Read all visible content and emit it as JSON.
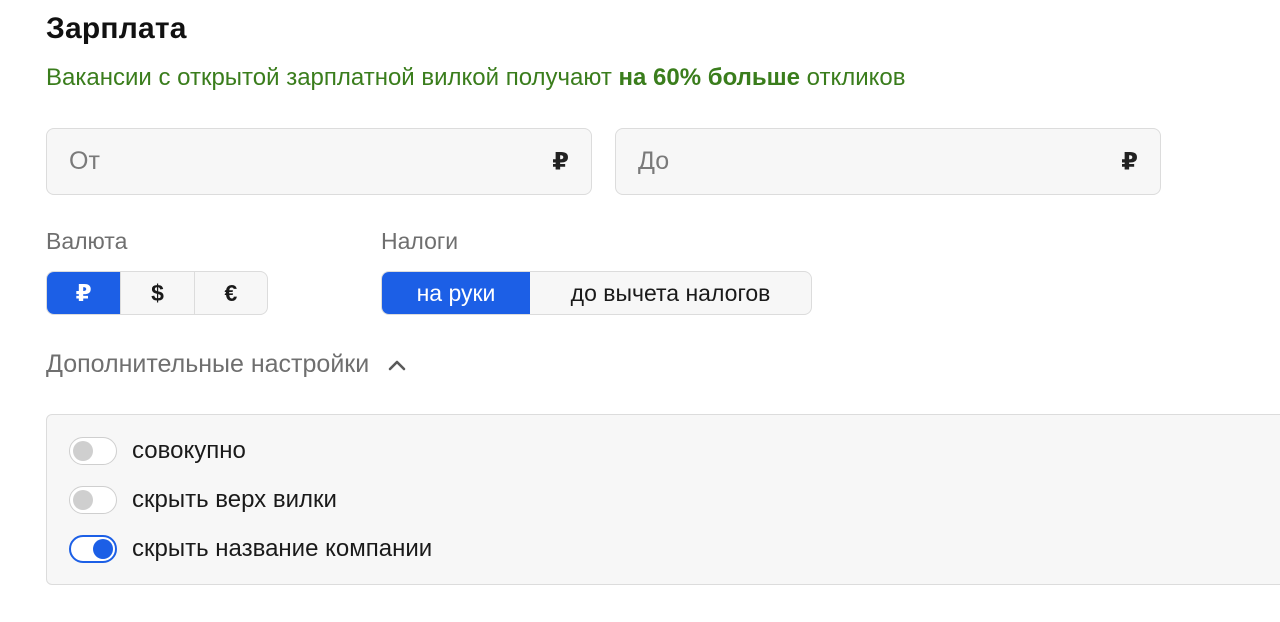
{
  "title": "Зарплата",
  "promo": {
    "prefix": "Вакансии с открытой зарплатной вилкой получают ",
    "highlight": "на 60% больше",
    "suffix": " откликов"
  },
  "salary": {
    "from": {
      "placeholder": "От",
      "value": "",
      "currency_sign": "₽"
    },
    "to": {
      "placeholder": "До",
      "value": "",
      "currency_sign": "₽"
    }
  },
  "currency": {
    "label": "Валюта",
    "options": [
      "₽",
      "$",
      "€"
    ],
    "selected": "₽"
  },
  "taxes": {
    "label": "Налоги",
    "options": [
      "на руки",
      "до вычета налогов"
    ],
    "selected": "на руки"
  },
  "advanced": {
    "label": "Дополнительные настройки",
    "expanded": true,
    "options": [
      {
        "label": "совокупно",
        "checked": false
      },
      {
        "label": "скрыть верх вилки",
        "checked": false
      },
      {
        "label": "скрыть название компании",
        "checked": true
      }
    ]
  },
  "colors": {
    "accent": "#1c5fe6",
    "promo_text": "#3a7d1c",
    "field_bg": "#f7f7f7",
    "border": "#dcdcdc",
    "muted_text": "#6f6f6f"
  },
  "icons": {
    "advanced_toggle": "chevron-up-icon"
  }
}
